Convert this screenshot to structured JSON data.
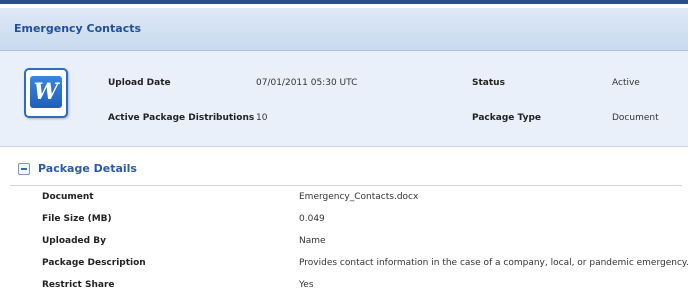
{
  "panel": {
    "title": "Emergency Contacts"
  },
  "summary": {
    "icon": "word-document-icon",
    "upload_date_label": "Upload Date",
    "upload_date_value": "07/01/2011 05:30 UTC",
    "status_label": "Status",
    "status_value": "Active",
    "distributions_label": "Active Package Distributions",
    "distributions_value": "10",
    "package_type_label": "Package Type",
    "package_type_value": "Document"
  },
  "details": {
    "section_title": "Package Details",
    "rows": [
      {
        "label": "Document",
        "value": "Emergency_Contacts.docx"
      },
      {
        "label": "File Size (MB)",
        "value": "0.049"
      },
      {
        "label": "Uploaded By",
        "value": "Name"
      },
      {
        "label": "Package Description",
        "value": "Provides contact information in the case of a company, local, or pandemic emergency."
      },
      {
        "label": "Restrict Share",
        "value": "Yes"
      }
    ]
  },
  "colors": {
    "top_border": "#2a4d8f",
    "title_text": "#1f4f9a",
    "summary_bg": "#eaf0fa",
    "section_title": "#2a5aa8"
  }
}
